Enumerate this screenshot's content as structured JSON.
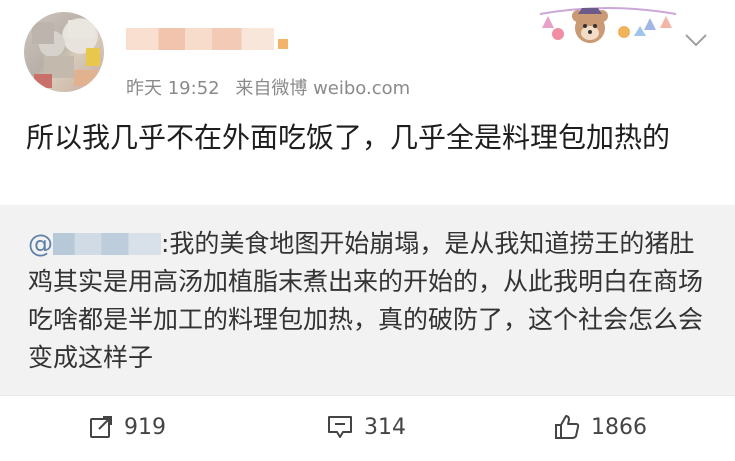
{
  "post": {
    "time": "昨天 19:52",
    "source": "来自微博 weibo.com",
    "text": "所以我几乎不在外面吃饭了，几乎全是料理包加热的"
  },
  "repost": {
    "at": "@",
    "text": ":我的美食地图开始崩塌，是从我知道捞王的猪肚鸡其实是用高汤加植脂末煮出来的开始的，从此我明白在商场吃啥都是半加工的料理包加热，真的破防了，这个社会怎么会变成这样子"
  },
  "actions": {
    "share_count": "919",
    "comment_count": "314",
    "like_count": "1866"
  }
}
